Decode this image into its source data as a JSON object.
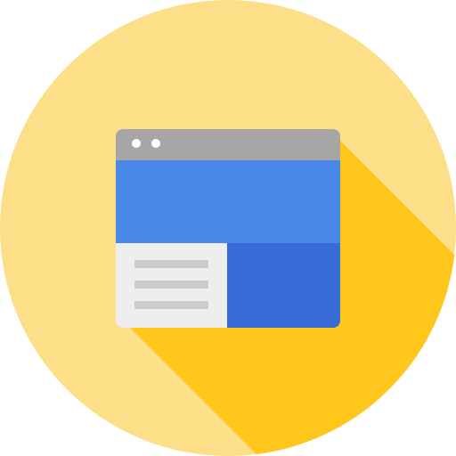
{
  "icon": {
    "name": "browser-window-icon",
    "colors": {
      "circle_background": "#FDDF87",
      "long_shadow": "#FFC61B",
      "title_bar": "#A6A6A6",
      "window_dots": "#FFFFFF",
      "header_panel": "#4A89E8",
      "sidebar_panel": "#EEEEEE",
      "sidebar_lines": "#CCCCCC",
      "content_panel": "#376CD6"
    }
  }
}
